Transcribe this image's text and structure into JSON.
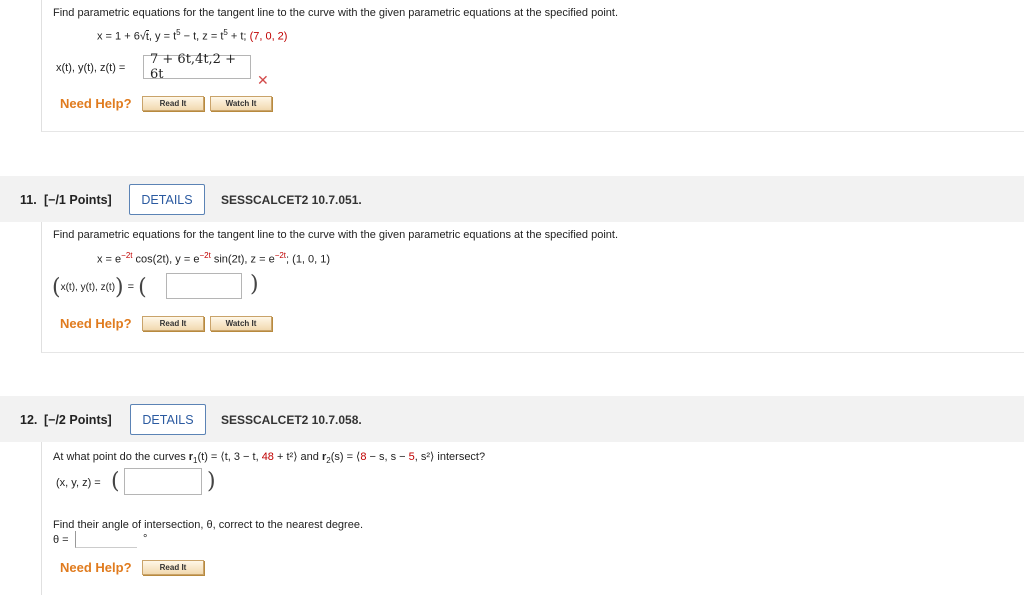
{
  "q10": {
    "prompt": "Find parametric equations for the tangent line to the curve with the given parametric equations at the specified point.",
    "eq_x": "x = 1 + 6",
    "eq_sqrt_arg": "t",
    "eq_y": ", y = t",
    "eq_y_exp": "5",
    "eq_y_rest": " − t, z = t",
    "eq_z_exp": "5",
    "eq_z_rest": " + t;",
    "point": "(7, 0, 2)",
    "answer_label": "x(t), y(t), z(t) =",
    "answer_value": "7 + 6t,4t,2 + 6t",
    "result_mark": "✕"
  },
  "q11": {
    "number": "11.",
    "points": "[−/1 Points]",
    "details_label": "DETAILS",
    "code": "SESSCALCET2 10.7.051.",
    "prompt": "Find parametric equations for the tangent line to the curve with the given parametric equations at the specified point.",
    "eq_x": "x = e",
    "eq_x_exp": "−2t",
    "eq_x_rest": " cos(2t), y = e",
    "eq_y_exp": "−2t",
    "eq_y_rest": " sin(2t), z = e",
    "eq_z_exp": "−2t",
    "eq_z_rest": ";",
    "point": "(1, 0, 1)",
    "answer_label": "x(t), y(t), z(t)",
    "answer_value": ""
  },
  "q12": {
    "number": "12.",
    "points": "[−/2 Points]",
    "details_label": "DETAILS",
    "code": "SESSCALCET2 10.7.058.",
    "prompt_start": "At what point do the curves ",
    "r1": "r",
    "r1_sub": "1",
    "r1_def": "(t) = ⟨t, 3 − t, ",
    "r1_red": "48",
    "r1_end": " + t²⟩",
    "and": " and ",
    "r2": "r",
    "r2_sub": "2",
    "r2_def": "(s) = ⟨",
    "r2_red": "8",
    "r2_mid": " − s, s − ",
    "r2_red2": "5",
    "r2_end": ", s²⟩",
    "prompt_end": " intersect?",
    "xyz_label": "(x, y, z) =",
    "xyz_value": "",
    "angle_prompt": "Find their angle of intersection, θ, correct to the nearest degree.",
    "theta_label": "θ =",
    "degree": "°",
    "theta_value": ""
  },
  "help": {
    "need_help": "Need Help?",
    "read_it": "Read It",
    "watch_it": "Watch It"
  }
}
